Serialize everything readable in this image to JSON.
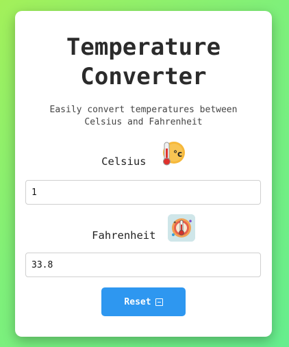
{
  "app": {
    "title": "Temperature Converter",
    "subtitle": "Easily convert temperatures between Celsius and Fahrenheit"
  },
  "celsius": {
    "label": "Celsius",
    "icon": "thermometer-celsius-icon",
    "value": "1"
  },
  "fahrenheit": {
    "label": "Fahrenheit",
    "icon": "thermometer-fahrenheit-icon",
    "value": "33.8"
  },
  "reset": {
    "label": "Reset",
    "icon": "calculator-icon"
  },
  "colors": {
    "accent": "#2e97f0",
    "background_start": "#a3f05a",
    "background_end": "#66ee8e",
    "card": "#ffffff",
    "text": "#2b2b2b"
  }
}
